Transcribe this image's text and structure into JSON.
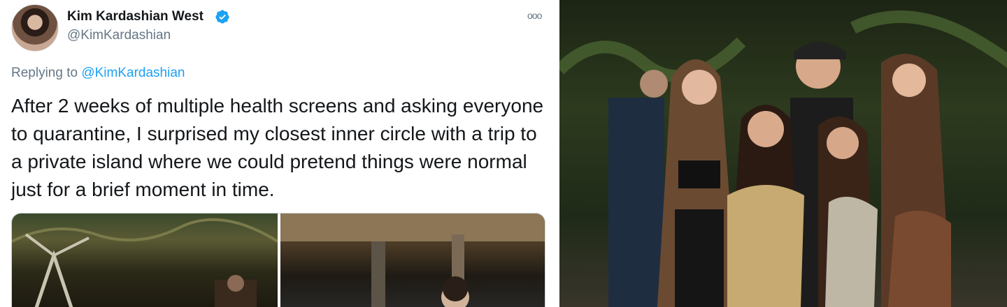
{
  "tweet": {
    "display_name": "Kim Kardashian West",
    "handle": "@KimKardashian",
    "replying_prefix": "Replying to ",
    "replying_handle": "@KimKardashian",
    "text": "After 2 weeks of multiple health screens and asking everyone to quarantine, I surprised my closest inner circle with a trip to a private island where we could pretend things were normal just for a brief moment in time.",
    "more_label": "ooo"
  },
  "colors": {
    "accent": "#1da1f2",
    "text": "#14171a",
    "secondary": "#657786"
  },
  "icons": {
    "verified": "verified-badge-icon",
    "more": "more-options-icon"
  }
}
